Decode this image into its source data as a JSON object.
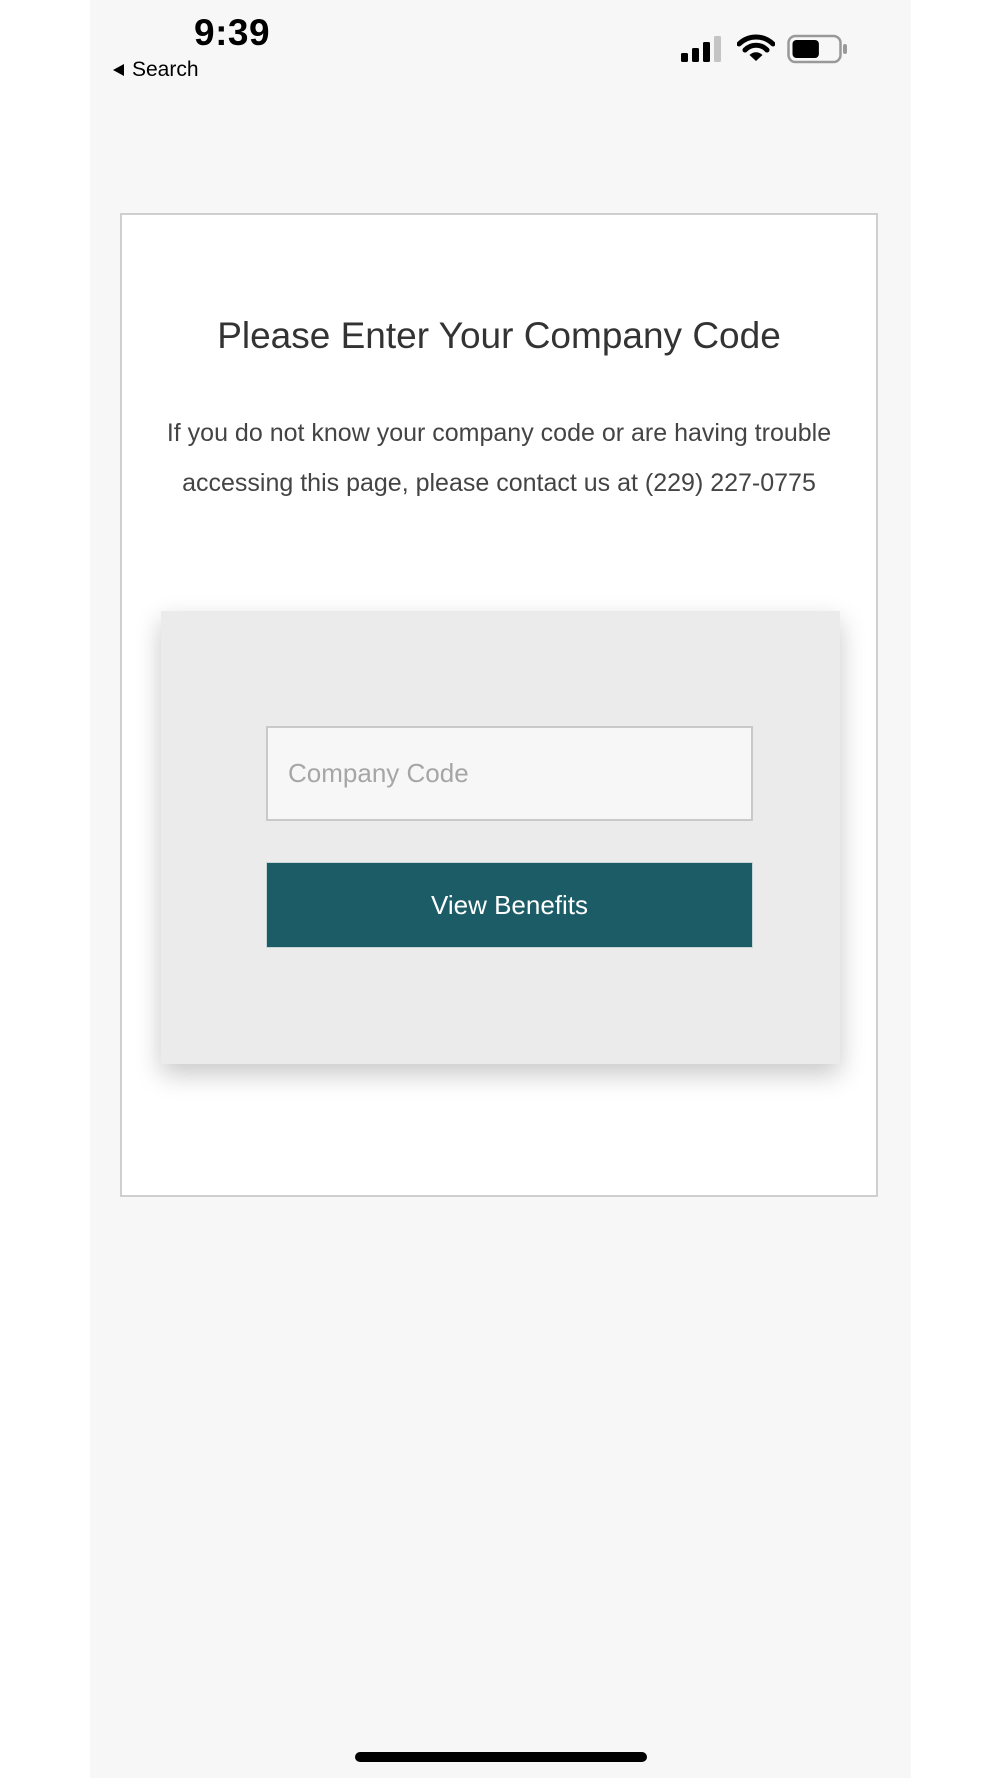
{
  "status_bar": {
    "time": "9:39",
    "back_label": "Search",
    "battery_level": 0.6
  },
  "page": {
    "title": "Please Enter Your Company Code",
    "description": "If you do not know your company code or are having trouble accessing this page, please contact us at (229) 227-0775",
    "input_placeholder": "Company Code",
    "input_value": "",
    "button_label": "View Benefits"
  },
  "colors": {
    "primary_button": "#1b5c66",
    "page_background": "#f7f7f7",
    "panel_background": "#ebebeb"
  },
  "icons": [
    "back-arrow-icon",
    "cellular-signal-icon",
    "wifi-icon",
    "battery-icon"
  ]
}
